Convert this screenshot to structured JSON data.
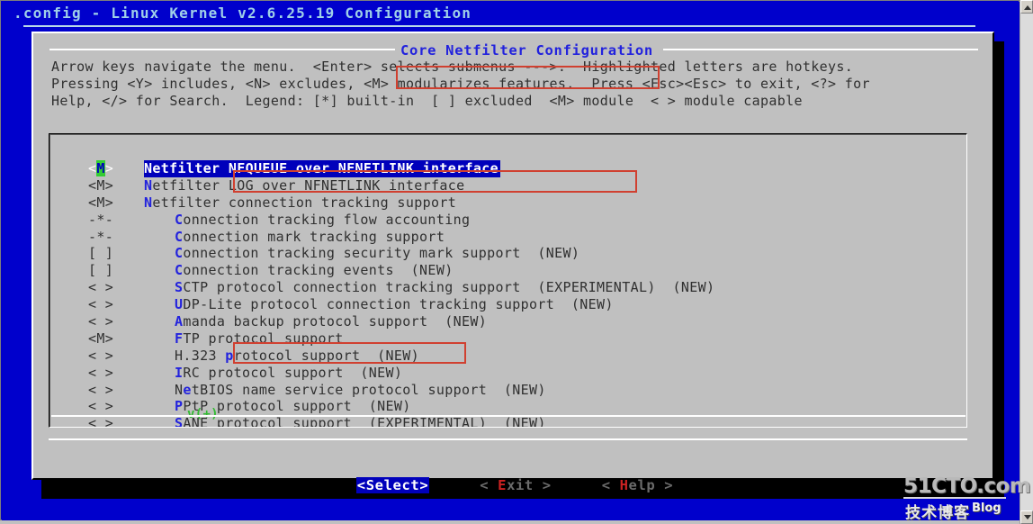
{
  "window": {
    "terminal_title": ".config - Linux Kernel v2.6.25.19 Configuration",
    "colors": {
      "terminal_bg": "#0000cc",
      "dialog_bg": "#c0c0c0",
      "highlight_bg": "#0000bb",
      "hotkey": "#2222dd",
      "cursor_green": "#33cc33",
      "annotation_red": "#d04030",
      "button_hotkey_red": "#cc2222"
    }
  },
  "dialog": {
    "title": "Core Netfilter Configuration",
    "help_text": "Arrow keys navigate the menu.  <Enter> selects submenus --->.  Highlighted letters are hotkeys.\nPressing <Y> includes, <N> excludes, <M> modularizes features.  Press <Esc><Esc> to exit, <?> for\nHelp, </> for Search.  Legend: [*] built-in  [ ] excluded  <M> module  < > module capable",
    "scroll_marker": "v(+)"
  },
  "menu": {
    "items": [
      {
        "state": "<M>",
        "indent": 0,
        "hot": "N",
        "pre": "",
        "post": "etfilter NFQUEUE over NFNETLINK interface",
        "label": "Netfilter NFQUEUE over NFNETLINK interface",
        "selected": true,
        "cursor_char": "M",
        "annotated": true
      },
      {
        "state": "<M>",
        "indent": 0,
        "hot": "N",
        "pre": "",
        "post": "etfilter LOG over NFNETLINK interface",
        "label": "Netfilter LOG over NFNETLINK interface",
        "selected": false,
        "annotated": false
      },
      {
        "state": "<M>",
        "indent": 0,
        "hot": "N",
        "pre": "",
        "post": "etfilter connection tracking support",
        "label": "Netfilter connection tracking support",
        "selected": false,
        "annotated": false
      },
      {
        "state": "-*-",
        "indent": 1,
        "hot": "C",
        "pre": "",
        "post": "onnection tracking flow accounting",
        "label": "Connection tracking flow accounting",
        "selected": false,
        "annotated": false
      },
      {
        "state": "-*-",
        "indent": 1,
        "hot": "C",
        "pre": "",
        "post": "onnection mark tracking support",
        "label": "Connection mark tracking support",
        "selected": false,
        "annotated": false
      },
      {
        "state": "[ ]",
        "indent": 1,
        "hot": "C",
        "pre": "",
        "post": "onnection tracking security mark support  (NEW)",
        "label": "Connection tracking security mark support  (NEW)",
        "selected": false,
        "annotated": false
      },
      {
        "state": "[ ]",
        "indent": 1,
        "hot": "C",
        "pre": "",
        "post": "onnection tracking events  (NEW)",
        "label": "Connection tracking events  (NEW)",
        "selected": false,
        "annotated": false
      },
      {
        "state": "< >",
        "indent": 1,
        "hot": "S",
        "pre": "",
        "post": "CTP protocol connection tracking support  (EXPERIMENTAL)  (NEW)",
        "label": "SCTP protocol connection tracking support  (EXPERIMENTAL)  (NEW)",
        "selected": false,
        "annotated": false
      },
      {
        "state": "< >",
        "indent": 1,
        "hot": "U",
        "pre": "",
        "post": "DP-Lite protocol connection tracking support  (NEW)",
        "label": "UDP-Lite protocol connection tracking support  (NEW)",
        "selected": false,
        "annotated": false
      },
      {
        "state": "< >",
        "indent": 1,
        "hot": "A",
        "pre": "",
        "post": "manda backup protocol support  (NEW)",
        "label": "Amanda backup protocol support  (NEW)",
        "selected": false,
        "annotated": false
      },
      {
        "state": "<M>",
        "indent": 1,
        "hot": "F",
        "pre": "",
        "post": "TP protocol support",
        "label": "FTP protocol support",
        "selected": false,
        "annotated": true
      },
      {
        "state": "< >",
        "indent": 1,
        "hot": "p",
        "pre": "H.323 ",
        "post": "rotocol support  (NEW)",
        "label": "H.323 protocol support  (NEW)",
        "selected": false,
        "annotated": false
      },
      {
        "state": "< >",
        "indent": 1,
        "hot": "I",
        "pre": "",
        "post": "RC protocol support  (NEW)",
        "label": "IRC protocol support  (NEW)",
        "selected": false,
        "annotated": false
      },
      {
        "state": "< >",
        "indent": 1,
        "hot": "e",
        "pre": "N",
        "post": "tBIOS name service protocol support  (NEW)",
        "label": "NetBIOS name service protocol support  (NEW)",
        "selected": false,
        "annotated": false
      },
      {
        "state": "< >",
        "indent": 1,
        "hot": "P",
        "pre": "",
        "post": "PtP protocol support  (NEW)",
        "label": "PPtP protocol support  (NEW)",
        "selected": false,
        "annotated": false
      },
      {
        "state": "< >",
        "indent": 1,
        "hot": "S",
        "pre": "",
        "post": "ANE protocol support  (EXPERIMENTAL)  (NEW)",
        "label": "SANE protocol support  (EXPERIMENTAL)  (NEW)",
        "selected": false,
        "annotated": false
      }
    ]
  },
  "buttons": [
    {
      "text": "<Select>",
      "pre": "<",
      "hot": "S",
      "post": "elect>",
      "active": true
    },
    {
      "text": "< Exit >",
      "pre": "< ",
      "hot": "E",
      "post": "xit >",
      "active": false
    },
    {
      "text": "< Help >",
      "pre": "< ",
      "hot": "H",
      "post": "elp >",
      "active": false
    }
  ],
  "watermark": {
    "line1": "51CTO.com",
    "line2": "技术博客",
    "line3": "Blog"
  },
  "scrollbar": {
    "up_arrow": "scroll-up",
    "down_arrow": "scroll-down"
  }
}
